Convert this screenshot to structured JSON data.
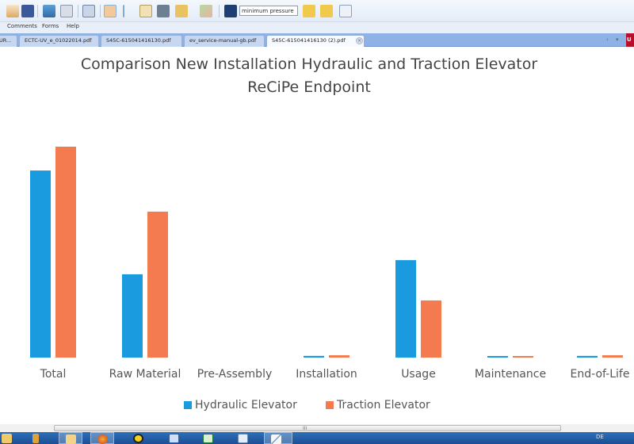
{
  "app": {
    "toolbar": {
      "search_value": "minimum pressure",
      "icons": [
        "email-icon",
        "facebook-icon",
        "monitor-icon",
        "print-preview-icon",
        "save-icon",
        "hand-tool-icon",
        "select-tool-icon",
        "snapshot-icon",
        "camera-icon",
        "stamp-icon",
        "sign-icon",
        "find-icon",
        "find-prev-icon",
        "find-next-icon",
        "export-icon"
      ]
    },
    "menu": [
      "Comments",
      "Forms",
      "Help"
    ],
    "tabs": [
      {
        "label": "UR...",
        "active": false
      },
      {
        "label": "ECTC-UV_e_01022014.pdf",
        "active": false
      },
      {
        "label": "S45C-615041416130.pdf",
        "active": false
      },
      {
        "label": "ev_service-manual-gb.pdf",
        "active": false
      },
      {
        "label": "S45C-615041416130 (2).pdf",
        "active": true
      }
    ],
    "tab_close_glyph": "×",
    "tab_nav": [
      "‹",
      "▾"
    ],
    "badge_text": "U",
    "scroll_grip": "III",
    "taskbar": {
      "apps": [
        "explorer-icon",
        "folder-icon",
        "firefox-icon",
        "sync-icon",
        "word-icon",
        "excel-icon",
        "notepad-icon",
        "pdf-editor-icon"
      ],
      "active_index": 7,
      "language": "DE"
    }
  },
  "chart_data": {
    "type": "bar",
    "title": "Comparison New Installation Hydraulic and Traction Elevator",
    "subtitle": "ReCiPe Endpoint",
    "xlabel": "",
    "ylabel": "",
    "ylim": [
      0,
      100
    ],
    "grid": false,
    "legend_position": "bottom",
    "categories": [
      "Total",
      "Raw Material",
      "Pre-Assembly",
      "Installation",
      "Usage",
      "Maintenance",
      "End-of-Life"
    ],
    "series": [
      {
        "name": "Hydraulic Elevator",
        "color": "#1a9be0",
        "values": [
          88.7,
          39.5,
          0,
          0.8,
          46.2,
          0.4,
          0.8
        ]
      },
      {
        "name": "Traction Elevator",
        "color": "#f47b4f",
        "values": [
          100,
          69.2,
          0,
          1.1,
          27.1,
          0.4,
          1.1
        ]
      }
    ]
  }
}
